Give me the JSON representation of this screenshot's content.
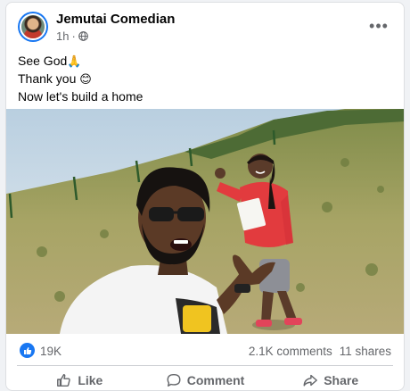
{
  "post": {
    "author": "Jemutai Comedian",
    "time": "1h",
    "privacy_icon": "globe-icon",
    "more_icon": "more-options-icon",
    "more_label": "•••",
    "caption": [
      {
        "text": "See God",
        "emoji": "🙏"
      },
      {
        "text": "Thank you",
        "emoji": "😊"
      },
      {
        "text": "Now let's build a home",
        "emoji": ""
      }
    ]
  },
  "stats": {
    "reaction_icon": "like-icon",
    "reaction_count": "19K",
    "comments": "2.1K comments",
    "shares": "11 shares"
  },
  "actions": {
    "like": "Like",
    "comment": "Comment",
    "share": "Share"
  },
  "colors": {
    "brand": "#1877f2",
    "muted_text": "#65676b",
    "divider": "#ced0d4"
  }
}
